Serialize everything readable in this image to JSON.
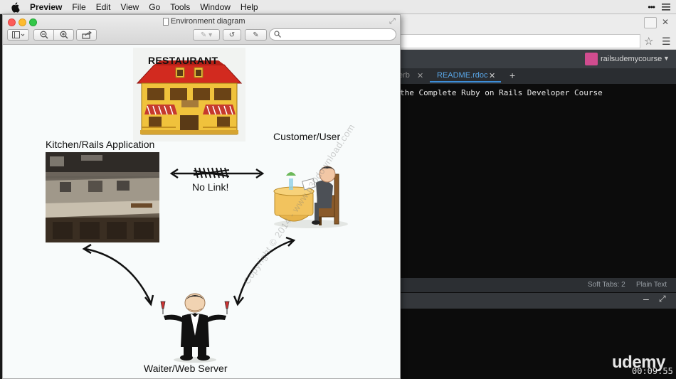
{
  "menubar": {
    "items": [
      "Preview",
      "File",
      "Edit",
      "View",
      "Go",
      "Tools",
      "Window",
      "Help"
    ]
  },
  "preview": {
    "window_title": "Environment diagram",
    "toolbar": {
      "sidebar_icon": "sidebar-icon",
      "zoom_out_icon": "zoom-out-icon",
      "zoom_in_icon": "zoom-in-icon",
      "share_icon": "share-icon",
      "markup_icon": "pen-icon",
      "rotate_icon": "rotate-icon",
      "edit_icon": "edit-icon",
      "search_placeholder": ""
    },
    "diagram": {
      "restaurant_label": "RESTAURANT",
      "kitchen_label": "Kitchen/Rails Application",
      "customer_label": "Customer/User",
      "no_link_label": "No Link!",
      "waiter_label": "Waiter/Web Server",
      "watermark": "Copyright © 2014 - www.p30download.com"
    }
  },
  "editor": {
    "user": "railsudemycourse",
    "tabs": [
      {
        "label": "erb"
      },
      {
        "label": "README.rdoc",
        "active": true
      }
    ],
    "code_line": "the Complete Ruby on Rails Developer Course",
    "status": {
      "soft_tabs": "Soft Tabs: 2",
      "mode": "Plain Text"
    }
  },
  "overlay": {
    "brand": "udemy",
    "timer": "00:09:55"
  },
  "colors": {
    "close": "#fc5b57",
    "minimize": "#fdbb2f",
    "zoom": "#33c748",
    "active_tab": "#5aa7e8",
    "user_badge": "#d04c8f"
  }
}
